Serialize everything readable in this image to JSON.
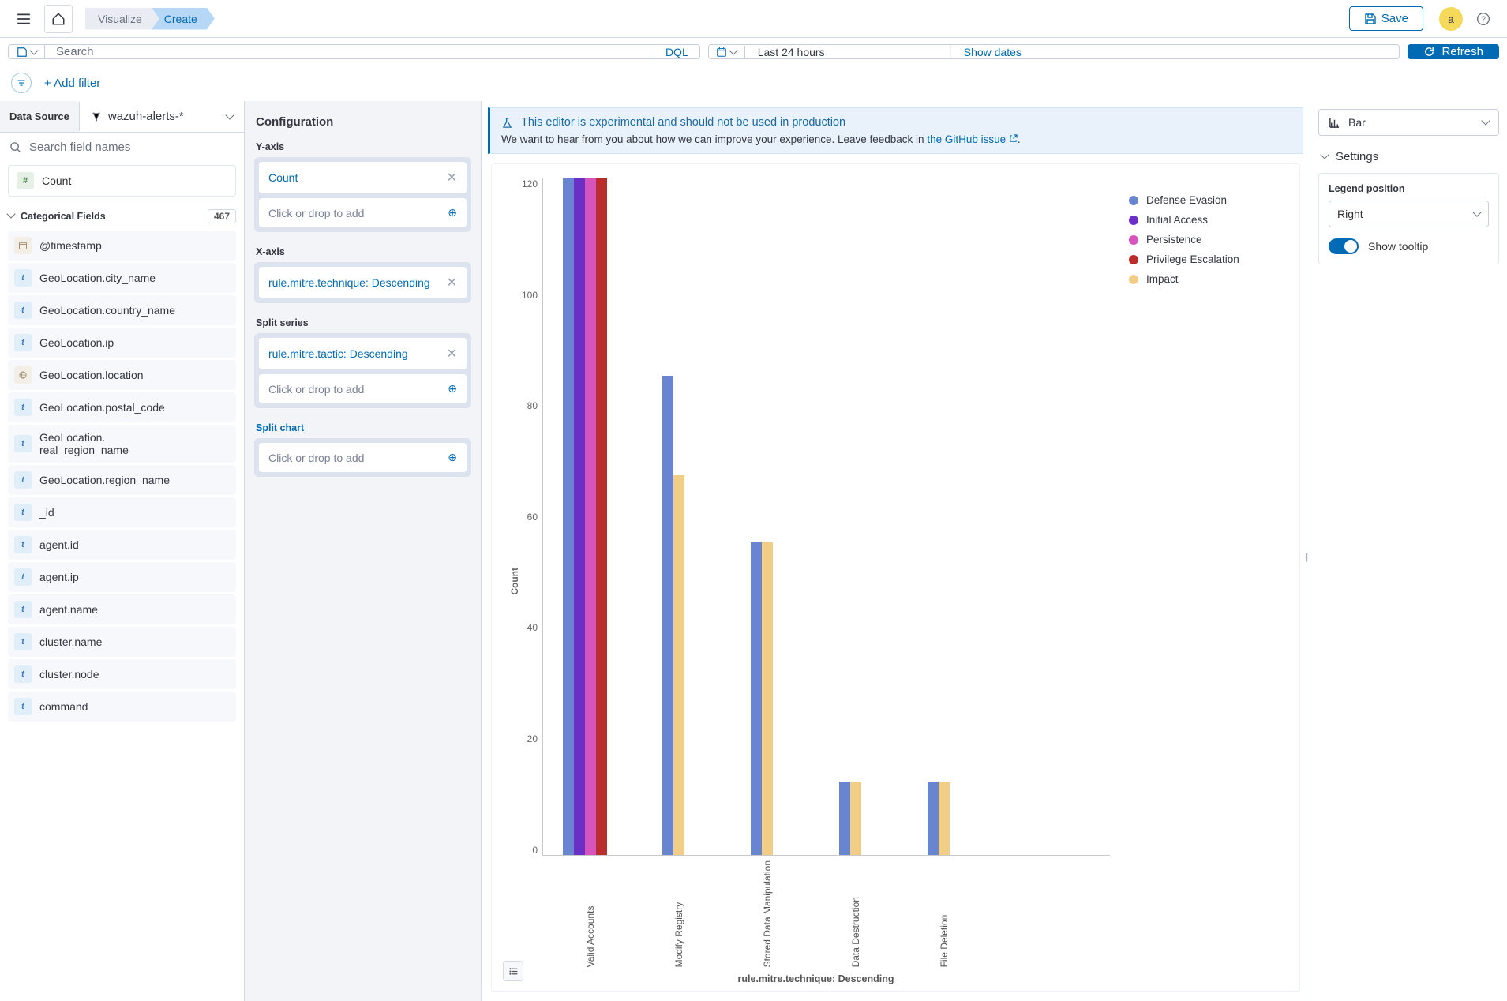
{
  "header": {
    "breadcrumbs": [
      "Visualize",
      "Create"
    ],
    "save_label": "Save",
    "avatar_letter": "a"
  },
  "query": {
    "search_placeholder": "Search",
    "dql_label": "DQL",
    "date_range": "Last 24 hours",
    "show_dates_label": "Show dates",
    "refresh_label": "Refresh",
    "add_filter_label": "+ Add filter"
  },
  "left": {
    "data_source_label": "Data Source",
    "data_source_value": "wazuh-alerts-*",
    "field_search_placeholder": "Search field names",
    "available_field_label": "Count",
    "cat_header": "Categorical Fields",
    "cat_count": "467",
    "fields": [
      {
        "type": "date",
        "name": "@timestamp"
      },
      {
        "type": "t",
        "name": "GeoLocation.city_name"
      },
      {
        "type": "t",
        "name": "GeoLocation.country_name"
      },
      {
        "type": "t",
        "name": "GeoLocation.ip"
      },
      {
        "type": "globe",
        "name": "GeoLocation.location"
      },
      {
        "type": "t",
        "name": "GeoLocation.postal_code"
      },
      {
        "type": "t",
        "name": "GeoLocation.\nreal_region_name"
      },
      {
        "type": "t",
        "name": "GeoLocation.region_name"
      },
      {
        "type": "t",
        "name": "_id"
      },
      {
        "type": "t",
        "name": "agent.id"
      },
      {
        "type": "t",
        "name": "agent.ip"
      },
      {
        "type": "t",
        "name": "agent.name"
      },
      {
        "type": "t",
        "name": "cluster.name"
      },
      {
        "type": "t",
        "name": "cluster.node"
      },
      {
        "type": "t",
        "name": "command"
      }
    ]
  },
  "config": {
    "title": "Configuration",
    "y_axis_label": "Y-axis",
    "y_chip": "Count",
    "x_axis_label": "X-axis",
    "x_chip_field": "rule.mitre.technique",
    "x_chip_suffix": ": Descending",
    "split_series_label": "Split series",
    "split_chip_field": "rule.mitre.tactic",
    "split_chip_suffix": ": Descending",
    "split_chart_label": "Split chart",
    "drop_placeholder": "Click or drop to add"
  },
  "callout": {
    "title": "This editor is experimental and should not be used in production",
    "body_prefix": "We want to hear from you about how we can improve your experience. Leave feedback in ",
    "link_text": "the GitHub issue",
    "body_suffix": "."
  },
  "right": {
    "chart_type": "Bar",
    "settings_label": "Settings",
    "legend_pos_label": "Legend position",
    "legend_pos_value": "Right",
    "tooltip_label": "Show tooltip",
    "tooltip_enabled": true
  },
  "chart_data": {
    "type": "bar",
    "title": "",
    "ylabel": "Count",
    "xlabel": "rule.mitre.technique: Descending",
    "ylim": [
      0,
      130
    ],
    "y_ticks": [
      120,
      100,
      80,
      60,
      40,
      20,
      0
    ],
    "categories": [
      "Valid Accounts",
      "Modify Registry",
      "Stored Data Manipulation",
      "Data Destruction",
      "File Deletion"
    ],
    "series_colors": {
      "Defense Evasion": "#6985d1",
      "Initial Access": "#6a2fc4",
      "Persistence": "#d554be",
      "Privilege Escalation": "#ba2d2d",
      "Impact": "#f2cd86"
    },
    "legend": [
      "Defense Evasion",
      "Initial Access",
      "Persistence",
      "Privilege Escalation",
      "Impact"
    ],
    "series": [
      {
        "name": "Defense Evasion",
        "values": [
          130,
          92,
          0,
          14,
          14
        ]
      },
      {
        "name": "Initial Access",
        "values": [
          130,
          0,
          0,
          0,
          0
        ]
      },
      {
        "name": "Persistence",
        "values": [
          130,
          0,
          0,
          0,
          0
        ]
      },
      {
        "name": "Privilege Escalation",
        "values": [
          130,
          0,
          0,
          0,
          0
        ]
      },
      {
        "name": "Impact",
        "values": [
          0,
          73,
          60,
          14,
          14
        ]
      }
    ],
    "stacks": {
      "Valid Accounts": [
        {
          "series": "Defense Evasion",
          "value": 130
        },
        {
          "series": "Initial Access",
          "value": 130
        },
        {
          "series": "Persistence",
          "value": 130
        },
        {
          "series": "Privilege Escalation",
          "value": 130
        }
      ],
      "Modify Registry": [
        {
          "series": "Defense Evasion",
          "value": 92
        },
        {
          "series": "Impact",
          "value": 73
        }
      ],
      "Stored Data Manipulation": [
        {
          "series": "Defense Evasion",
          "value": 60
        },
        {
          "series": "Impact",
          "value": 60
        }
      ],
      "Data Destruction": [
        {
          "series": "Defense Evasion",
          "value": 14
        },
        {
          "series": "Impact",
          "value": 14
        }
      ],
      "File Deletion": [
        {
          "series": "Defense Evasion",
          "value": 14
        },
        {
          "series": "Impact",
          "value": 14
        }
      ]
    }
  }
}
